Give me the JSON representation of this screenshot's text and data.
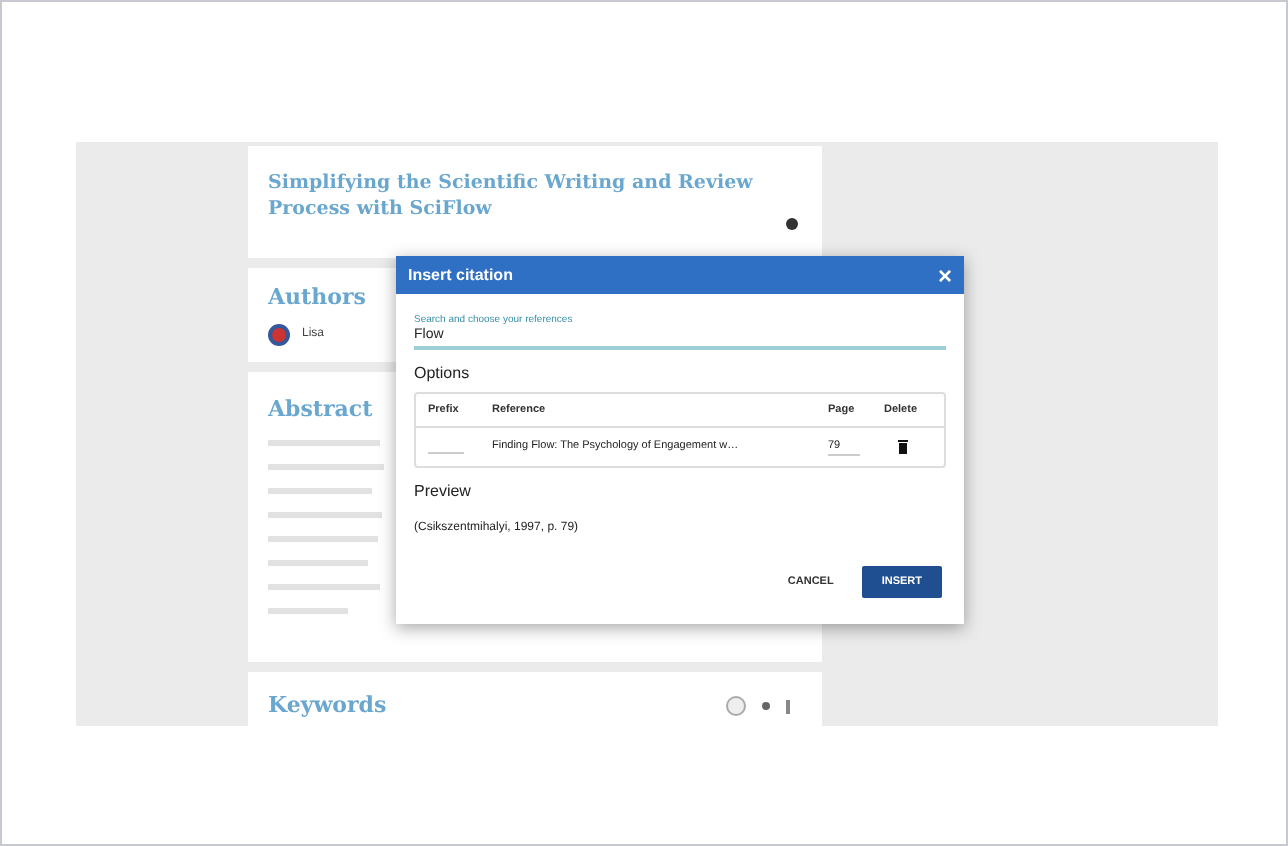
{
  "document": {
    "title": "Simplifying the Scientific Writing and Review Process with SciFlow",
    "authors": {
      "heading": "Authors",
      "items": [
        {
          "name": "Lisa"
        }
      ]
    },
    "abstract": {
      "heading": "Abstract"
    },
    "keywords": {
      "heading": "Keywords"
    }
  },
  "dialog": {
    "title": "Insert citation",
    "close": "×",
    "search": {
      "label": "Search and choose your references",
      "value": "Flow"
    },
    "options": {
      "heading": "Options",
      "columns": [
        "Prefix",
        "Reference",
        "Page",
        "Delete"
      ],
      "rows": [
        {
          "prefix": "",
          "reference": "Finding Flow: The Psychology of Engagement w…",
          "page": "79"
        }
      ]
    },
    "preview": {
      "heading": "Preview",
      "text": "(Csikszentmihalyi, 1997, p. 79)"
    },
    "buttons": [
      {
        "label": "CANCEL",
        "kind": "text"
      },
      {
        "label": "INSERT",
        "kind": "primary"
      }
    ]
  }
}
